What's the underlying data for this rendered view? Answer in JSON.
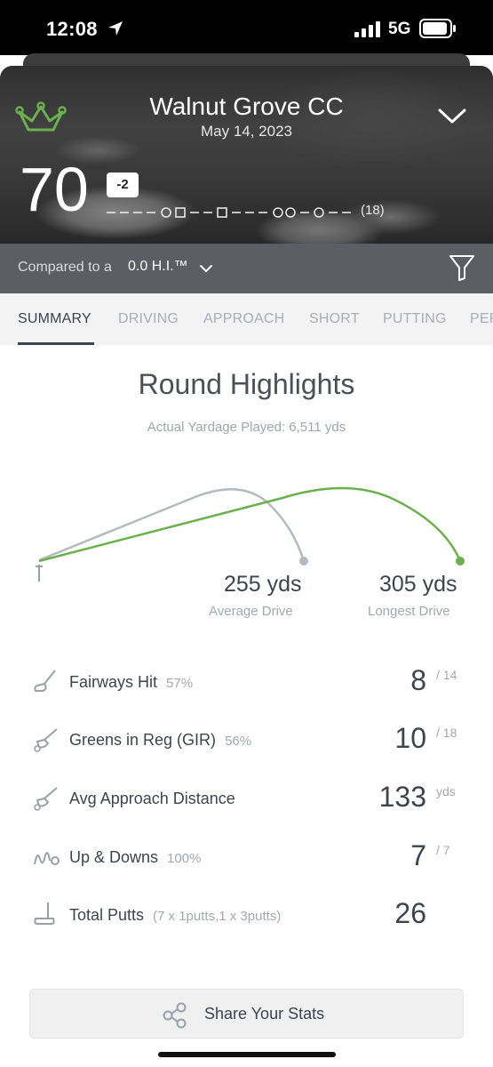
{
  "status_bar": {
    "time": "12:08",
    "network": "5G"
  },
  "round": {
    "course_name": "Walnut Grove CC",
    "date": "May 14, 2023",
    "score": "70",
    "to_par": "-2",
    "holes": "(18)"
  },
  "comparison": {
    "prefix": "Compared to a",
    "value": "0.0 H.I.™"
  },
  "tabs": [
    {
      "label": "SUMMARY",
      "active": true
    },
    {
      "label": "DRIVING",
      "active": false
    },
    {
      "label": "APPROACH",
      "active": false
    },
    {
      "label": "SHORT",
      "active": false
    },
    {
      "label": "PUTTING",
      "active": false
    },
    {
      "label": "PERF",
      "active": false
    }
  ],
  "highlights": {
    "title": "Round Highlights",
    "yardage_played": "Actual Yardage Played: 6,511 yds",
    "average_drive": {
      "value": "255 yds",
      "caption": "Average Drive",
      "color": "#b4b9c1"
    },
    "longest_drive": {
      "value": "305 yds",
      "caption": "Longest Drive",
      "color": "#6ab04c"
    }
  },
  "stats": [
    {
      "icon": "driver-club-icon",
      "label": "Fairways Hit",
      "pct": "57%",
      "value": "8",
      "suffix": "/ 14"
    },
    {
      "icon": "iron-club-icon",
      "label": "Greens in Reg (GIR)",
      "pct": "56%",
      "value": "10",
      "suffix": "/ 18"
    },
    {
      "icon": "iron-club-icon",
      "label": "Avg Approach Distance",
      "pct": "",
      "value": "133",
      "suffix": "yds"
    },
    {
      "icon": "chip-shot-icon",
      "label": "Up & Downs",
      "pct": "100%",
      "value": "7",
      "suffix": "/ 7"
    },
    {
      "icon": "putter-icon",
      "label": "Total Putts",
      "pct": "(7 x 1putts,1 x 3putts)",
      "value": "26",
      "suffix": ""
    }
  ],
  "share": {
    "label": "Share Your Stats"
  },
  "colors": {
    "accent_green": "#6ab04c",
    "text_dark": "#3d4450",
    "text_muted": "#a3a7ae"
  }
}
